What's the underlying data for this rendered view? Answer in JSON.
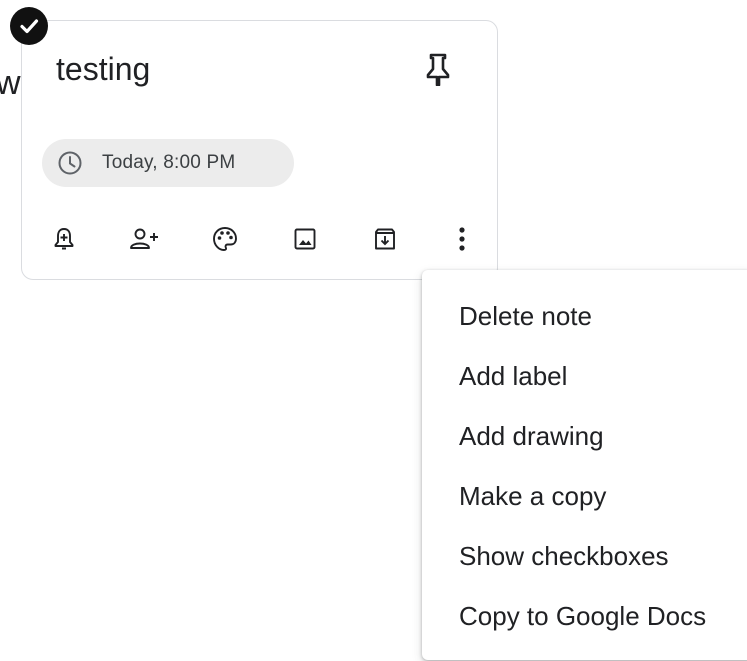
{
  "background": {
    "partial_text": "w"
  },
  "note": {
    "title": "testing",
    "reminder": {
      "label": "Today, 8:00 PM"
    },
    "toolbar": [
      {
        "name": "remind-me-button",
        "icon": "bell-plus-icon"
      },
      {
        "name": "collaborator-button",
        "icon": "person-add-icon"
      },
      {
        "name": "background-options-button",
        "icon": "palette-icon"
      },
      {
        "name": "add-image-button",
        "icon": "image-icon"
      },
      {
        "name": "archive-button",
        "icon": "archive-icon"
      },
      {
        "name": "more-button",
        "icon": "more-vert-icon"
      }
    ]
  },
  "menu": {
    "items": [
      "Delete note",
      "Add label",
      "Add drawing",
      "Make a copy",
      "Show checkboxes",
      "Copy to Google Docs"
    ]
  },
  "colors": {
    "text": "#202124",
    "icon": "#5f6368",
    "chip_bg": "#ececec",
    "card_border": "#dadce0"
  }
}
